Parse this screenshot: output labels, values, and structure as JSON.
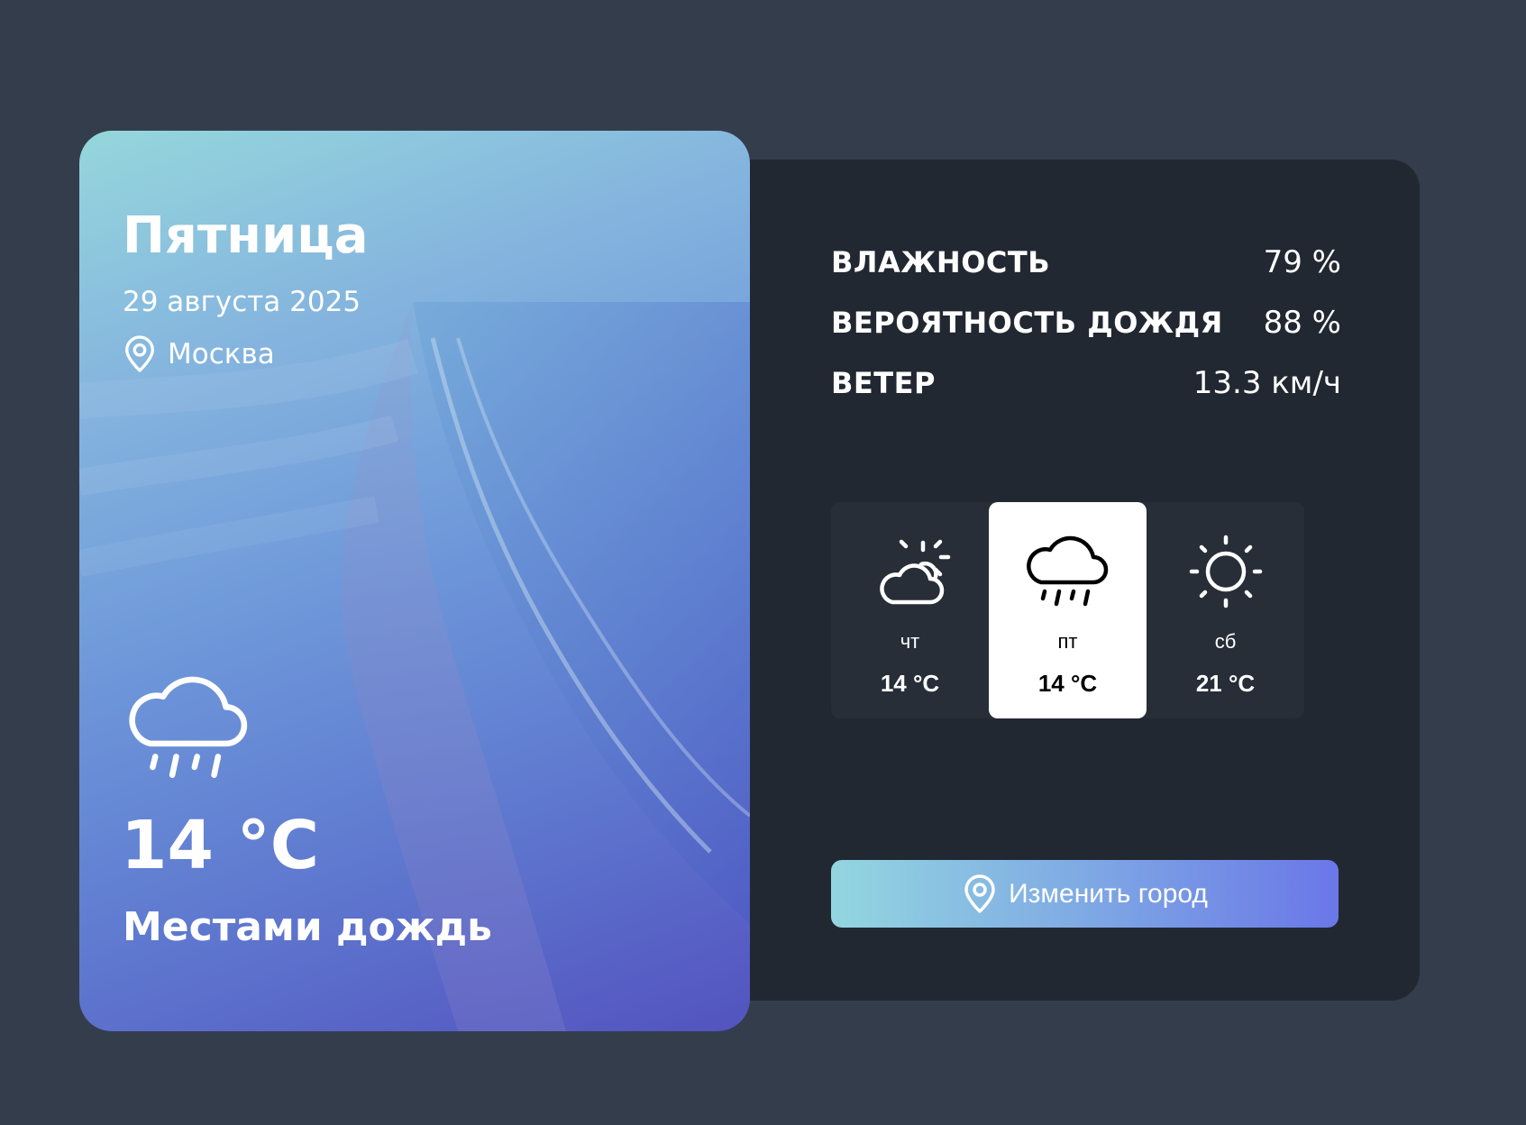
{
  "current": {
    "day": "Пятница",
    "date": "29 августа 2025",
    "city": "Москва",
    "temperature": "14 °C",
    "condition": "Местами дождь",
    "icon": "rain-cloud-icon"
  },
  "stats": [
    {
      "label": "ВЛАЖНОСТЬ",
      "value": "79 %"
    },
    {
      "label": "ВЕРОЯТНОСТЬ ДОЖДЯ",
      "value": "88 %"
    },
    {
      "label": "ВЕТЕР",
      "value": "13.3 км/ч"
    }
  ],
  "forecast": [
    {
      "day": "чт",
      "temp": "14 °C",
      "icon": "partly-cloudy-icon",
      "active": false
    },
    {
      "day": "пт",
      "temp": "14 °C",
      "icon": "rain-cloud-icon",
      "active": true
    },
    {
      "day": "сб",
      "temp": "21 °C",
      "icon": "sun-icon",
      "active": false
    }
  ],
  "button": {
    "label": "Изменить город",
    "icon": "location-pin-icon"
  },
  "colors": {
    "page_background": "#343d4c",
    "panel_background": "#222831",
    "button_gradient_start": "#93d6e0",
    "button_gradient_end": "#6a77e8",
    "active_day_background": "#ffffff"
  }
}
